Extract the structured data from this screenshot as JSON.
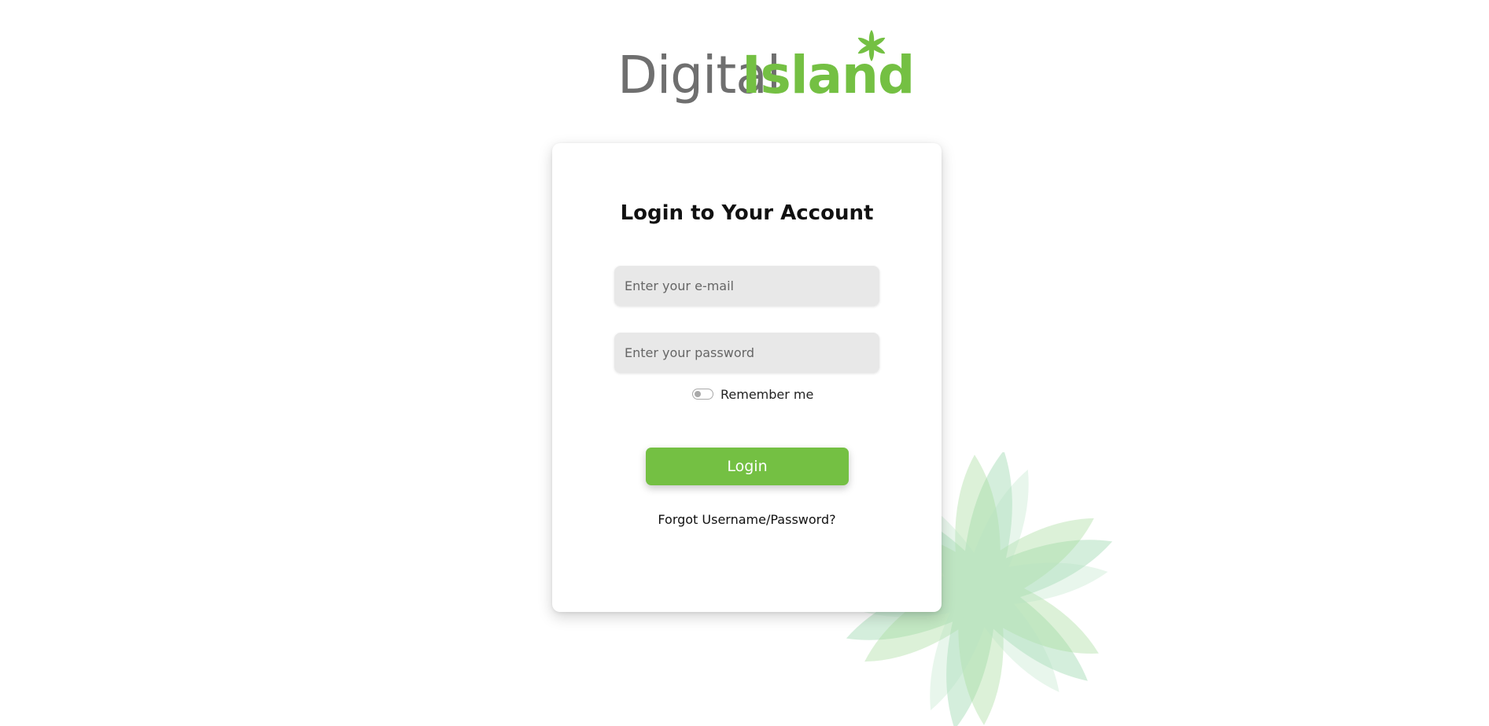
{
  "logo": {
    "word1": "Digital",
    "word2": "Island",
    "word1_color": "#6f6f6f",
    "word2_color": "#74c043"
  },
  "login_form": {
    "title": "Login to Your Account",
    "email_placeholder": "Enter your e-mail",
    "email_value": "",
    "password_placeholder": "Enter your password",
    "password_value": "",
    "remember_label": "Remember me",
    "remember_checked": false,
    "login_button_label": "Login",
    "forgot_link_label": "Forgot Username/Password?"
  },
  "colors": {
    "accent": "#74c043",
    "field_background": "#e8e8e8",
    "decoration": "#9fd8a8"
  },
  "icons": {
    "logo_mark": "asterisk-icon",
    "background_decoration": "asterisk-decoration-icon"
  }
}
